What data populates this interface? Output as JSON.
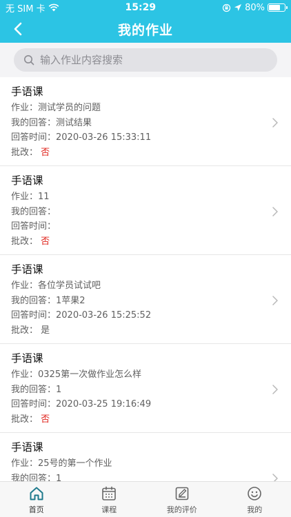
{
  "status_bar": {
    "carrier": "无 SIM 卡",
    "time": "15:29",
    "battery_percent": 80,
    "battery_label": "80%"
  },
  "nav": {
    "title": "我的作业"
  },
  "search": {
    "placeholder": "输入作业内容搜索"
  },
  "labels": {
    "homework": "作业：",
    "my_answer": "我的回答：",
    "answer_time": "回答时间：",
    "graded": "批改："
  },
  "items": [
    {
      "course": "手语课",
      "homework": "测试学员的问题",
      "answer": "测试结果",
      "time": "2020-03-26 15:33:11",
      "graded": "否"
    },
    {
      "course": "手语课",
      "homework": "11",
      "answer": "",
      "time": "",
      "graded": "否"
    },
    {
      "course": "手语课",
      "homework": "各位学员试试吧",
      "answer": "1苹果2",
      "time": "2020-03-26 15:25:52",
      "graded": "是"
    },
    {
      "course": "手语课",
      "homework": "0325第一次做作业怎么样",
      "answer": "1",
      "time": "2020-03-25 19:16:49",
      "graded": "否"
    },
    {
      "course": "手语课",
      "homework": "25号的第一个作业",
      "answer": "1",
      "time": "",
      "graded": ""
    }
  ],
  "tabs": [
    {
      "label": "首页",
      "icon": "home-icon",
      "active": true
    },
    {
      "label": "课程",
      "icon": "calendar-icon",
      "active": false
    },
    {
      "label": "我的评价",
      "icon": "edit-note-icon",
      "active": false
    },
    {
      "label": "我的",
      "icon": "smile-icon",
      "active": false
    }
  ],
  "colors": {
    "header": "#2cc4e4",
    "no_flag": "#e0241d",
    "tab_active": "#1f7a8c"
  }
}
